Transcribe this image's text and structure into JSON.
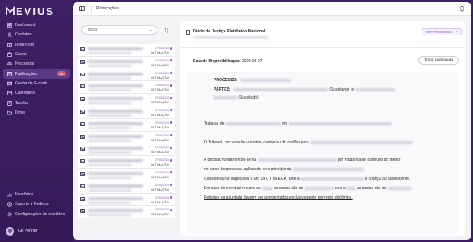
{
  "brand": {
    "name": "EVIUS",
    "accent": "#8d5ad0",
    "sidebar_bg": "#3e2064"
  },
  "sidebar": {
    "items": [
      {
        "label": "Dashboard",
        "icon": "dashboard-icon"
      },
      {
        "label": "Contatos",
        "icon": "contacts-icon"
      },
      {
        "label": "Financeiro",
        "icon": "finance-icon"
      },
      {
        "label": "Casos",
        "icon": "cases-icon"
      },
      {
        "label": "Processos",
        "icon": "processes-icon"
      },
      {
        "label": "Publicações",
        "icon": "publications-icon",
        "badge": "30",
        "active": true
      },
      {
        "label": "Gestor de E-mails",
        "icon": "email-icon"
      },
      {
        "label": "Calendário",
        "icon": "calendar-icon"
      },
      {
        "label": "Tarefas",
        "icon": "tasks-icon"
      },
      {
        "label": "Drive",
        "icon": "drive-icon"
      }
    ],
    "bottom_items": [
      {
        "label": "Relatórios",
        "icon": "reports-icon"
      },
      {
        "label": "Suporte e Pedidos",
        "icon": "support-icon"
      },
      {
        "label": "Configurações do escritório",
        "icon": "settings-icon"
      }
    ],
    "user": {
      "name": "Gil Penner",
      "more": "⋮"
    }
  },
  "topbar": {
    "title": "Publicações"
  },
  "list": {
    "filter_value": "Todos",
    "items": [
      {
        "date": "27/03/2026",
        "tag": "INTIMAÇÃO"
      },
      {
        "date": "27/03/2026",
        "tag": "INTIMAÇÃO"
      },
      {
        "date": "27/03/2026",
        "tag": "INTIMAÇÃO"
      },
      {
        "date": "27/03/2026",
        "tag": "INTIMAÇÃO"
      },
      {
        "date": "27/03/2026",
        "tag": "INTIMAÇÃO"
      },
      {
        "date": "27/03/2026",
        "tag": "INTIMAÇÃO"
      },
      {
        "date": "27/03/2026",
        "tag": "INTIMAÇÃO"
      },
      {
        "date": "27/03/2026",
        "tag": "INTIMAÇÃO"
      },
      {
        "date": "27/03/2026",
        "tag": "INTIMAÇÃO"
      },
      {
        "date": "27/03/2026",
        "tag": "INTIMAÇÃO"
      },
      {
        "date": "27/03/2026",
        "tag": "INTIMAÇÃO"
      },
      {
        "date": "27/03/2026",
        "tag": "INTIMAÇÃO"
      },
      {
        "date": "27/03/2026",
        "tag": "INTIMAÇÃO"
      },
      {
        "date": "27/03/2026",
        "tag": "INTIMAÇÃO"
      }
    ]
  },
  "detail": {
    "source": "Diário de Justiça Eletrônico Nacional",
    "version_label": "VER PROCESSO",
    "availability_label": "Data de Disponibilização:",
    "availability_date": "2026-03-27",
    "treat_button": "Tratar publicação",
    "processo_label": "PROCESSO:",
    "partes_label": "PARTES:",
    "suscitante": "(Suscitante) e",
    "suscitado": "(Suscitado).",
    "p1_start": "Trata-se de",
    "p1_mid": "em",
    "p2": "O Tribunal, por votação unânime, conheceu do conflito para",
    "p3_start": "A decisão fundamentou-se na",
    "p3_end": "por mudança de domicílio do menor",
    "p4_start": "no curso do processo, aplicando-se o princípio da",
    "p5_start": "Considerou-se inaplicável o art. 147, I, do ECA, ante a",
    "p5_end": "à criança ou adolescente.",
    "p6_a": "Em caso de eventual recurso ao",
    "p6_b": ", as custas são de",
    "p6_c": "; para o",
    "p6_d": ", as custas são de",
    "p7": "Petições para juntada deverm ser apresentadas exclusivamente por meio eletrônico."
  }
}
